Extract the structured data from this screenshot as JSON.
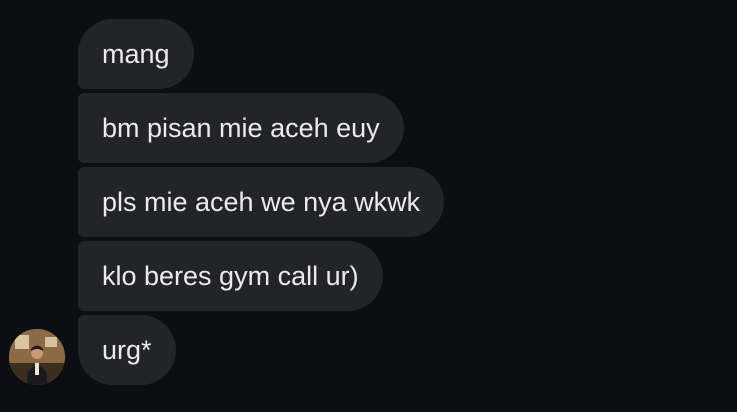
{
  "conversation": {
    "messages": [
      {
        "text": "mang"
      },
      {
        "text": "bm pisan mie aceh euy"
      },
      {
        "text": "pls mie aceh we nya wkwk"
      },
      {
        "text": "klo beres gym call ur)"
      },
      {
        "text": "urg*"
      }
    ],
    "avatar": {
      "icon": "user-avatar-photo"
    }
  },
  "colors": {
    "background": "#0d0e12",
    "bubble": "#232428",
    "text": "#ebebed"
  }
}
